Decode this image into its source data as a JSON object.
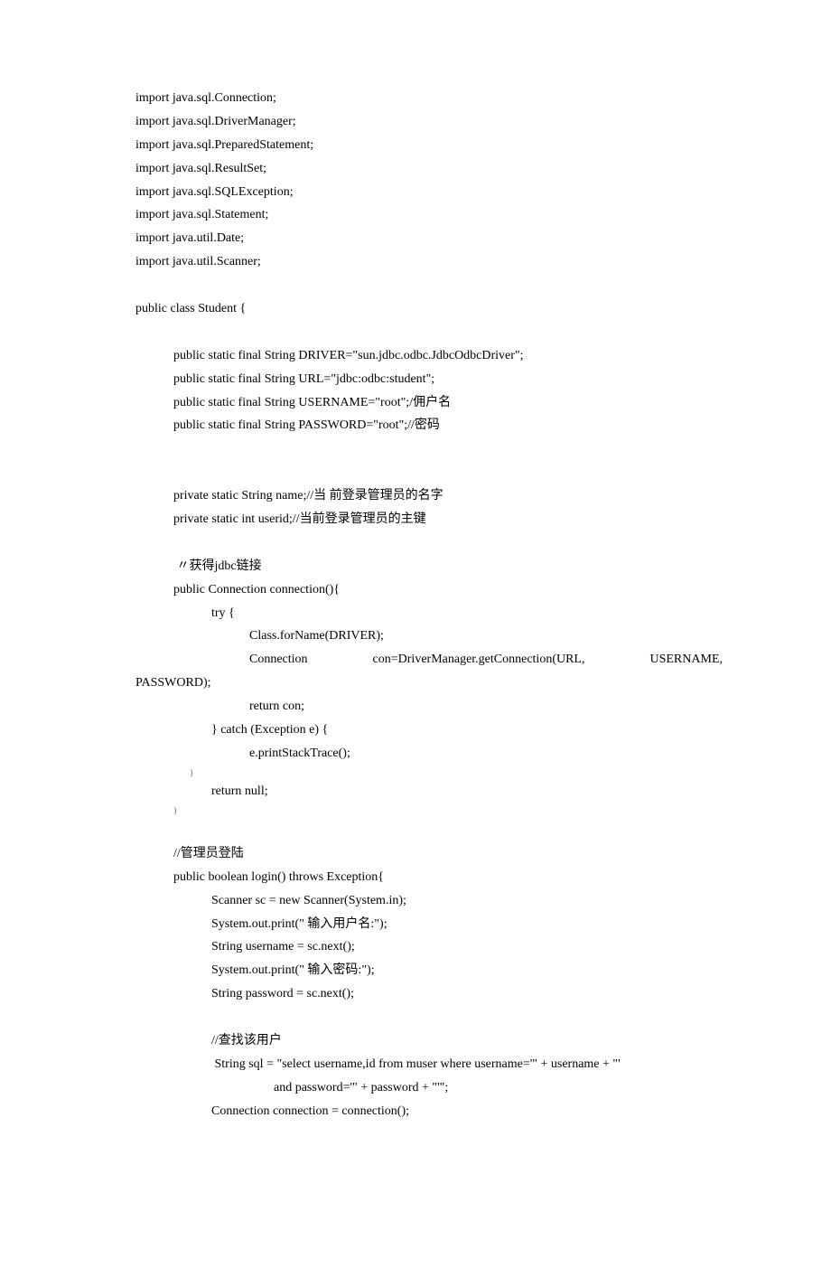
{
  "lines": {
    "l0": "import java.sql.Connection;",
    "l1": "import java.sql.DriverManager;",
    "l2": "import java.sql.PreparedStatement;",
    "l3": "import java.sql.ResultSet;",
    "l4": "import java.sql.SQLException;",
    "l5": "import java.sql.Statement;",
    "l6": "import java.util.Date;",
    "l7": "import java.util.Scanner;",
    "l8": "public class Student {",
    "l9": "public static final String DRIVER=\"sun.jdbc.odbc.JdbcOdbcDriver\";",
    "l10": "public static final String URL=\"jdbc:odbc:student\";",
    "l11": "public static final String USERNAME=\"root\";/佣户名",
    "l12": "public static final String PASSWORD=\"root\";//密码",
    "l13": "private static String name;//当 前登录管理员的名字",
    "l14": "private static int userid;//当前登录管理员的主键",
    "l15": " 〃获得jdbc链接",
    "l16": "public Connection connection(){",
    "l17": "try {",
    "l18": "Class.forName(DRIVER);",
    "conn_a": "Connection",
    "conn_b": "con=DriverManager.getConnection(URL,",
    "conn_c": "USERNAME,",
    "l20": "PASSWORD);",
    "l21": "return con;",
    "l22": "} catch (Exception e) {",
    "l23": "e.printStackTrace();",
    "l24": "}",
    "l25": "return null;",
    "l26": "}",
    "l27": "//管理员登陆",
    "l28": "public boolean login() throws Exception{",
    "l29": "Scanner sc = new Scanner(System.in);",
    "l30": "System.out.print(\" 输入用户名:\");",
    "l31": "String username = sc.next();",
    "l32": "System.out.print(\" 输入密码:\");",
    "l33": "String password = sc.next();",
    "l34": "//查找该用户",
    "l35": " String sql = \"select username,id from muser where username='\" + username + \"'",
    "l36": "and password='\" + password + \"'\";",
    "l37": "Connection connection = connection();"
  }
}
